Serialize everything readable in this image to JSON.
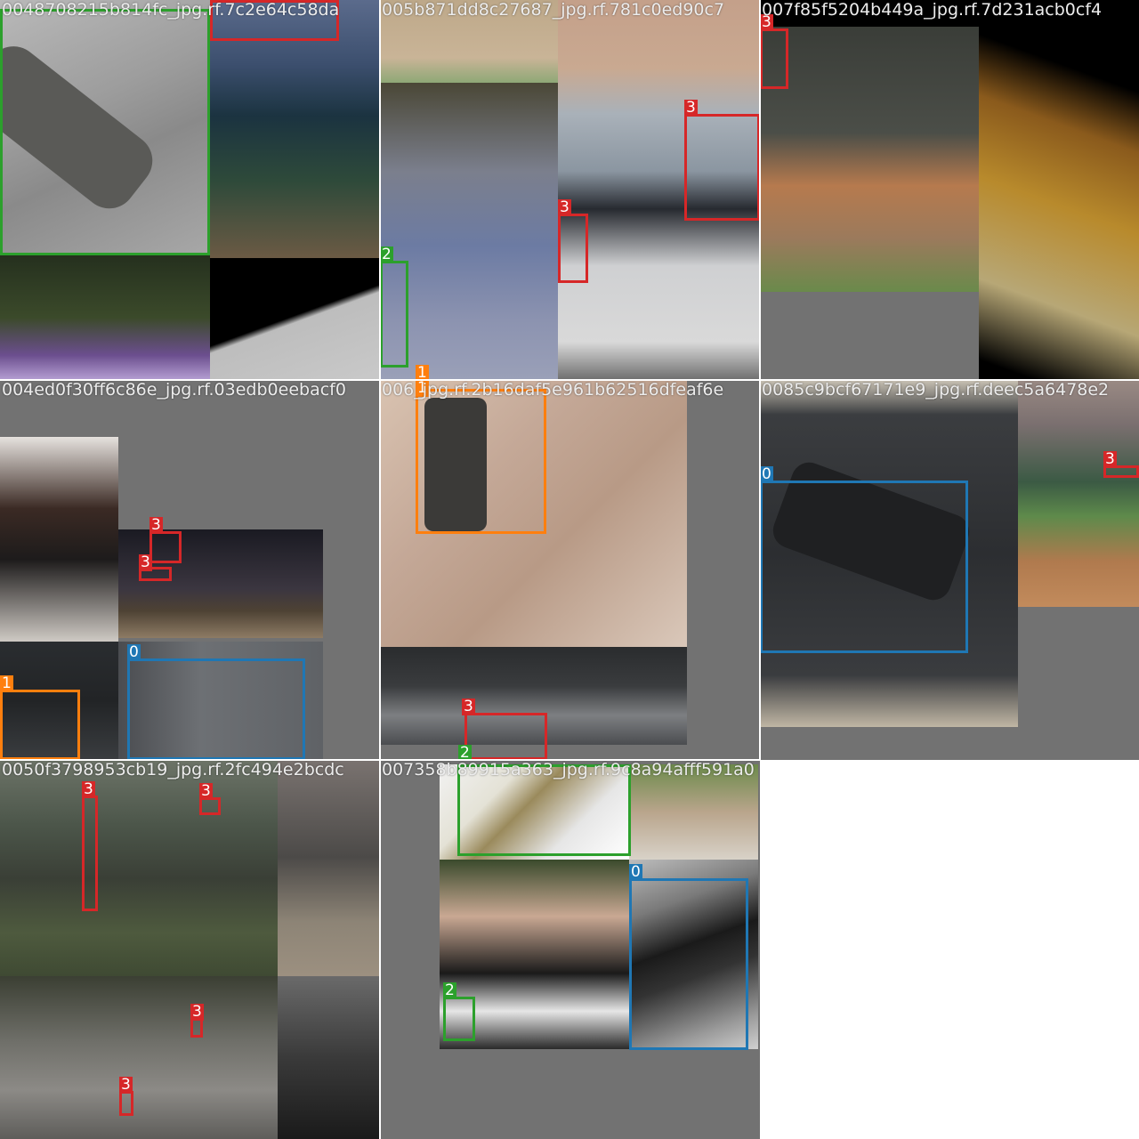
{
  "palette": {
    "class_0": "#1f77b4",
    "class_1": "#ff7f0e",
    "class_2": "#2ca02c",
    "class_3": "#d62728"
  },
  "tiles": [
    {
      "title": "0048708215b814fc_jpg.rf.7c2e64c58da"
    },
    {
      "title": "005b871dd8c27687_jpg.rf.781c0ed90c7"
    },
    {
      "title": "007f85f5204b449a_jpg.rf.7d231acb0cf4"
    },
    {
      "title": "004ed0f30ff6c86e_jpg.rf.03edb0eebacf0"
    },
    {
      "title": "006_jpg.rf.2b16daf5e961b62516dfeaf6e"
    },
    {
      "title": "0085c9bcf67171e9_jpg.rf.deec5a6478e2"
    },
    {
      "title": "0050f3798953cb19_jpg.rf.2fc494e2bcdc"
    },
    {
      "title": "007358b89915a363_jpg.rf.9c8a94afff591a0"
    }
  ],
  "labels": {
    "zero": "0",
    "one": "1",
    "two": "2",
    "three": "3"
  }
}
